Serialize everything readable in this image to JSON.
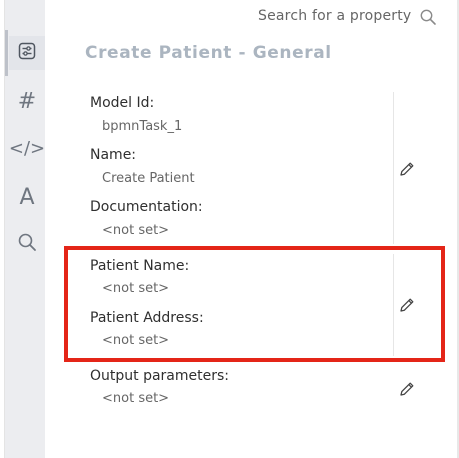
{
  "search": {
    "label": "Search for a property",
    "icon": "search-icon"
  },
  "panel": {
    "title": "Create Patient - General"
  },
  "sidebar": {
    "items": [
      {
        "name": "general-tab",
        "icon": "sliders-icon",
        "glyph": "",
        "active": true
      },
      {
        "name": "hash-tab",
        "icon": "hash-icon",
        "glyph": "#"
      },
      {
        "name": "code-tab",
        "icon": "code-icon",
        "glyph": "</>"
      },
      {
        "name": "font-tab",
        "icon": "font-icon",
        "glyph": "A"
      },
      {
        "name": "search-tab",
        "icon": "search-icon",
        "glyph": ""
      }
    ]
  },
  "groups": [
    {
      "fields": [
        {
          "label": "Model Id:",
          "value": "bpmnTask_1"
        },
        {
          "label": "Name:",
          "value": "Create Patient"
        },
        {
          "label": "Documentation:",
          "value": "<not set>"
        }
      ],
      "edit_icon": "pencil-icon"
    },
    {
      "fields": [
        {
          "label": "Patient Name:",
          "value": "<not set>"
        },
        {
          "label": "Patient Address:",
          "value": "<not set>"
        }
      ],
      "edit_icon": "pencil-icon",
      "highlighted": true
    },
    {
      "fields": [
        {
          "label": "Output parameters:",
          "value": "<not set>"
        }
      ],
      "edit_icon": "pencil-icon"
    }
  ],
  "colors": {
    "highlight": "#e42518",
    "title": "#abb5c0",
    "sidebar_bg": "#ecedf0"
  }
}
